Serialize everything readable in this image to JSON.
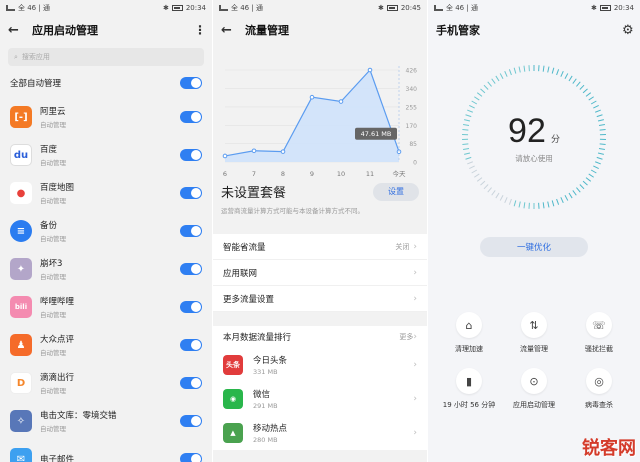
{
  "panel1": {
    "status": {
      "left": "全 46 | 通",
      "time": "20:34"
    },
    "title": "应用启动管理",
    "search_placeholder": "搜索应用",
    "all_label": "全部自动管理",
    "apps": [
      {
        "name": "阿里云",
        "sub": "自动管理",
        "color": "#f47a25",
        "glyph": "[-]"
      },
      {
        "name": "百度",
        "sub": "自动管理",
        "color": "#ffffff",
        "glyph": "du"
      },
      {
        "name": "百度地图",
        "sub": "自动管理",
        "color": "#ffffff",
        "glyph": "●"
      },
      {
        "name": "备份",
        "sub": "自动管理",
        "color": "#2a7cf0",
        "glyph": "≡"
      },
      {
        "name": "崩坏3",
        "sub": "自动管理",
        "color": "#b3a6c9",
        "glyph": "✦"
      },
      {
        "name": "哔哩哔哩",
        "sub": "自动管理",
        "color": "#f48bb0",
        "glyph": "bili"
      },
      {
        "name": "大众点评",
        "sub": "自动管理",
        "color": "#f56b2a",
        "glyph": "♟"
      },
      {
        "name": "滴滴出行",
        "sub": "自动管理",
        "color": "#ffffff",
        "glyph": "D"
      },
      {
        "name": "电击文库：零境交错",
        "sub": "自动管理",
        "color": "#5877b8",
        "glyph": "✧"
      },
      {
        "name": "电子邮件",
        "sub": "",
        "color": "#3da0f0",
        "glyph": "✉"
      }
    ]
  },
  "panel2": {
    "status": {
      "left": "全 46 | 通",
      "time": "20:45"
    },
    "title": "流量管理",
    "chart_data": {
      "type": "area",
      "x": [
        "6",
        "7",
        "8",
        "9",
        "10",
        "11",
        "今天"
      ],
      "values": [
        28,
        52,
        48,
        300,
        280,
        426,
        47.61
      ],
      "yticks": [
        0,
        85,
        170,
        255,
        340,
        426
      ],
      "ylim": [
        0,
        426
      ],
      "callout": "47.61 MB"
    },
    "plan_title": "未设置套餐",
    "plan_button": "设置",
    "plan_note": "运营商流量计算方式可能与本设备计算方式不同。",
    "settings": [
      {
        "label": "智能省流量",
        "value": "关闭"
      },
      {
        "label": "应用联网",
        "value": ""
      },
      {
        "label": "更多流量设置",
        "value": ""
      }
    ],
    "rank_title": "本月数据流量排行",
    "rank_more": "更多",
    "rank": [
      {
        "name": "今日头条",
        "size": "331 MB",
        "color": "#e13c3c",
        "glyph": "头条"
      },
      {
        "name": "微信",
        "size": "291 MB",
        "color": "#29b64b",
        "glyph": "◉"
      },
      {
        "name": "移动热点",
        "size": "280 MB",
        "color": "#4aa24f",
        "glyph": "▲"
      }
    ]
  },
  "panel3": {
    "status": {
      "left": "全 46 | 通",
      "time": "20:34"
    },
    "title": "手机管家",
    "score": "92",
    "score_unit": "分",
    "score_text": "请放心使用",
    "optimize": "一键优化",
    "tools": [
      {
        "label": "清理加速",
        "icon": "broom-icon",
        "glyph": "⌂"
      },
      {
        "label": "流量管理",
        "icon": "data-icon",
        "glyph": "⇅"
      },
      {
        "label": "骚扰拦截",
        "icon": "phone-block-icon",
        "glyph": "☏"
      },
      {
        "label": "19 小时 56 分钟",
        "icon": "battery-icon",
        "glyph": "▮"
      },
      {
        "label": "应用启动管理",
        "icon": "app-launch-icon",
        "glyph": "⊙"
      },
      {
        "label": "病毒查杀",
        "icon": "shield-icon",
        "glyph": "◎"
      }
    ]
  },
  "watermark": "锐客网"
}
